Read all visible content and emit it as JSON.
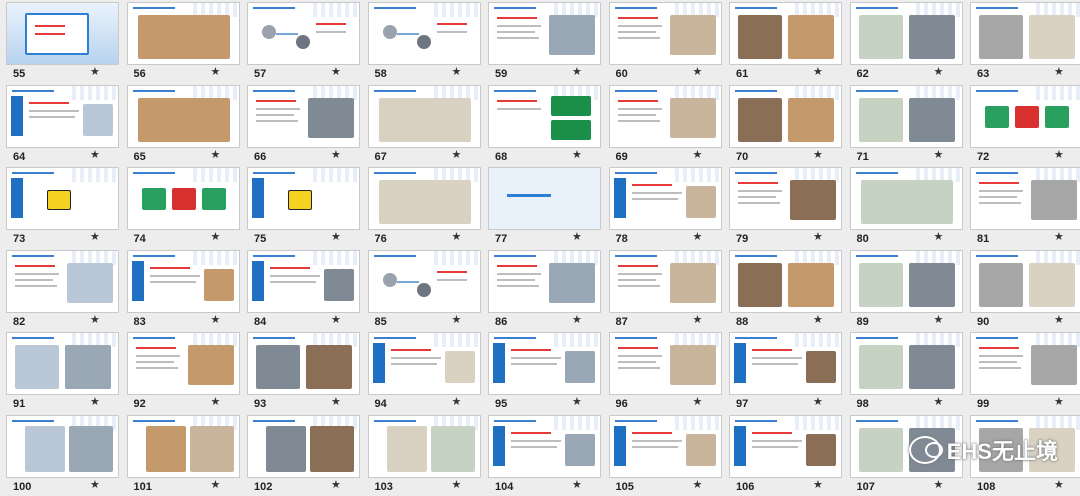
{
  "slides": [
    {
      "number": "55",
      "style": "cover"
    },
    {
      "number": "56",
      "style": "photo-wide"
    },
    {
      "number": "57",
      "style": "diagram"
    },
    {
      "number": "58",
      "style": "diagram"
    },
    {
      "number": "59",
      "style": "text-photo"
    },
    {
      "number": "60",
      "style": "text-photo"
    },
    {
      "number": "61",
      "style": "photos"
    },
    {
      "number": "62",
      "style": "photos"
    },
    {
      "number": "63",
      "style": "photos"
    },
    {
      "number": "64",
      "style": "sidebar-text"
    },
    {
      "number": "65",
      "style": "photo-wide"
    },
    {
      "number": "66",
      "style": "text-photo"
    },
    {
      "number": "67",
      "style": "photo-wide"
    },
    {
      "number": "68",
      "style": "text-signs"
    },
    {
      "number": "69",
      "style": "text-photo"
    },
    {
      "number": "70",
      "style": "photos"
    },
    {
      "number": "71",
      "style": "photos"
    },
    {
      "number": "72",
      "style": "signs"
    },
    {
      "number": "73",
      "style": "sidebar-sign"
    },
    {
      "number": "74",
      "style": "signs"
    },
    {
      "number": "75",
      "style": "sidebar-sign"
    },
    {
      "number": "76",
      "style": "photo-wide"
    },
    {
      "number": "77",
      "style": "title"
    },
    {
      "number": "78",
      "style": "sidebar-text"
    },
    {
      "number": "79",
      "style": "text-photo"
    },
    {
      "number": "80",
      "style": "photo-wide"
    },
    {
      "number": "81",
      "style": "text-photo"
    },
    {
      "number": "82",
      "style": "text-photo"
    },
    {
      "number": "83",
      "style": "sidebar-text"
    },
    {
      "number": "84",
      "style": "sidebar-text"
    },
    {
      "number": "85",
      "style": "diagram"
    },
    {
      "number": "86",
      "style": "text-photo"
    },
    {
      "number": "87",
      "style": "text-photo"
    },
    {
      "number": "88",
      "style": "photos"
    },
    {
      "number": "89",
      "style": "photos"
    },
    {
      "number": "90",
      "style": "photos"
    },
    {
      "number": "91",
      "style": "photos"
    },
    {
      "number": "92",
      "style": "text-photo"
    },
    {
      "number": "93",
      "style": "photos"
    },
    {
      "number": "94",
      "style": "sidebar-text"
    },
    {
      "number": "95",
      "style": "sidebar-text"
    },
    {
      "number": "96",
      "style": "text-photo"
    },
    {
      "number": "97",
      "style": "sidebar-text"
    },
    {
      "number": "98",
      "style": "photos"
    },
    {
      "number": "99",
      "style": "text-photo"
    },
    {
      "number": "100",
      "style": "sidebar-photo"
    },
    {
      "number": "101",
      "style": "sidebar-photo"
    },
    {
      "number": "102",
      "style": "sidebar-photo"
    },
    {
      "number": "103",
      "style": "sidebar-photo"
    },
    {
      "number": "104",
      "style": "sidebar-text"
    },
    {
      "number": "105",
      "style": "sidebar-text"
    },
    {
      "number": "106",
      "style": "sidebar-text"
    },
    {
      "number": "107",
      "style": "photos"
    },
    {
      "number": "108",
      "style": "photos"
    }
  ],
  "star_glyph": "★",
  "watermark": {
    "text": "EHS无止境",
    "icon": "wechat-logo-icon"
  },
  "colors": {
    "accent": "#1f6fc3",
    "alert": "#e63a3a",
    "background": "#ededed"
  }
}
